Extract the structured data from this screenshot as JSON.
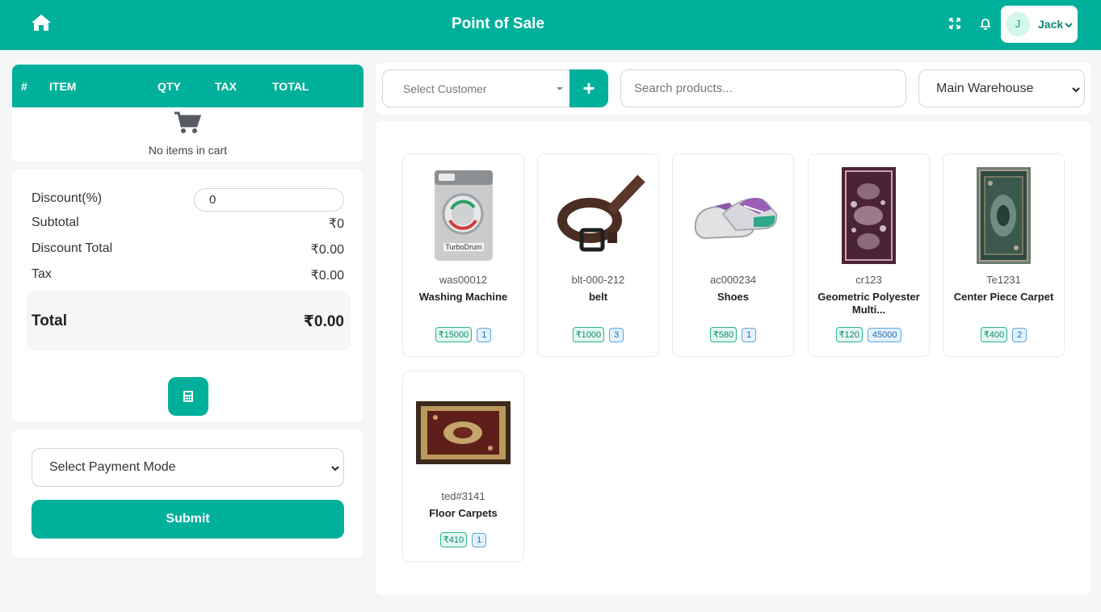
{
  "header": {
    "title": "Point of Sale",
    "user": {
      "initial": "J",
      "name": "Jack"
    }
  },
  "cart": {
    "columns": [
      "#",
      "ITEM",
      "QTY",
      "TAX",
      "TOTAL"
    ],
    "empty_text": "No items in cart"
  },
  "summary": {
    "discount_label": "Discount(%)",
    "discount_value": "0",
    "subtotal_label": "Subtotal",
    "subtotal_value": "₹0",
    "discount_total_label": "Discount Total",
    "discount_total_value": "₹0.00",
    "tax_label": "Tax",
    "tax_value": "₹0.00",
    "total_label": "Total",
    "total_value": "₹0.00"
  },
  "payment": {
    "select_label": "Select Payment Mode",
    "submit_label": "Submit"
  },
  "toolbar": {
    "customer_placeholder": "Select Customer",
    "search_placeholder": "Search products...",
    "warehouse_selected": "Main Warehouse"
  },
  "products": [
    {
      "code": "was00012",
      "name": "Washing Machine",
      "price": "₹15000",
      "qty": "1"
    },
    {
      "code": "blt-000-212",
      "name": "belt",
      "price": "₹1000",
      "qty": "3"
    },
    {
      "code": "ac000234",
      "name": "Shoes",
      "price": "₹580",
      "qty": "1"
    },
    {
      "code": "cr123",
      "name": "Geometric Polyester Multi...",
      "price": "₹120",
      "qty": "45000"
    },
    {
      "code": "Te1231",
      "name": "Center Piece Carpet",
      "price": "₹400",
      "qty": "2"
    },
    {
      "code": "ted#3141",
      "name": "Floor Carpets",
      "price": "₹410",
      "qty": "1"
    }
  ],
  "colors": {
    "brand": "#00b09b",
    "background": "#f4f6f8"
  }
}
